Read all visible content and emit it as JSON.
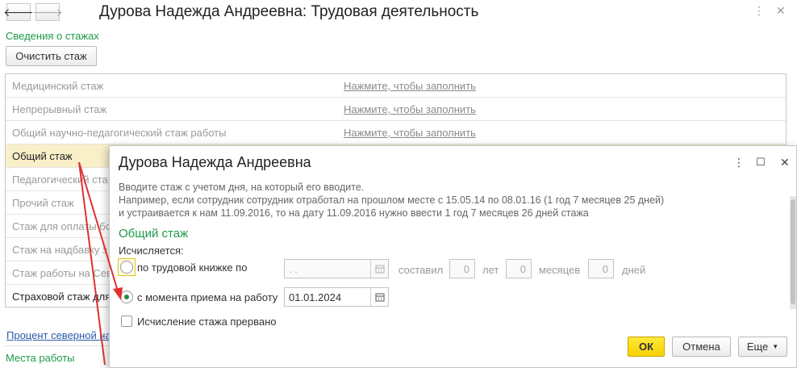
{
  "window": {
    "title": "Дурова Надежда Андреевна: Трудовая деятельность",
    "back_icon": "arrow-left-icon",
    "forward_icon": "arrow-right-icon",
    "more_icon": "more-vert-icon",
    "close_icon": "close-icon"
  },
  "stazh_section": {
    "title": "Сведения о стажах",
    "clear_button": "Очистить стаж"
  },
  "table": {
    "fill_link": "Нажмите, чтобы заполнить",
    "rows": [
      {
        "label": "Медицинский стаж",
        "value": "Нажмите, чтобы заполнить"
      },
      {
        "label": "Непрерывный стаж",
        "value": "Нажмите, чтобы заполнить"
      },
      {
        "label": "Общий научно-педагогический стаж работы",
        "value": "Нажмите, чтобы заполнить"
      },
      {
        "label": "Общий стаж",
        "value": ""
      },
      {
        "label": "Педагогический ста",
        "value": ""
      },
      {
        "label": "Прочий стаж",
        "value": ""
      },
      {
        "label": "Стаж для оплаты бо",
        "value": ""
      },
      {
        "label": "Стаж на надбавку з",
        "value": ""
      },
      {
        "label": "Стаж работы на Сев",
        "value": ""
      },
      {
        "label": "Страховой стаж для",
        "value": ""
      }
    ]
  },
  "bottom": {
    "northern_link": "Процент северной на",
    "workplaces": "Места работы"
  },
  "dialog": {
    "title": "Дурова Надежда Андреевна",
    "hint_lines": [
      "Вводите стаж с учетом дня, на который его вводите.",
      "Например, если сотрудник сотрудник отработал на прошлом месте с 15.05.14 по 08.01.16 (1 год 7 месяцев 25 дней)",
      "и устраивается к нам 11.09.2016, то на дату 11.09.2016 нужно ввести 1 год 7 месяцев 26 дней стажа"
    ],
    "section_title": "Общий стаж",
    "calculated_label": "Исчисляется:",
    "option_book": "по трудовой книжке по",
    "book_date": " .  .",
    "amounted_label": "составил",
    "years_value": "0",
    "years_label": "лет",
    "months_value": "0",
    "months_label": "месяцев",
    "days_value": "0",
    "days_label": "дней",
    "option_hire": "с момента приема на работу",
    "hire_date": "01.01.2024",
    "interrupted_label": "Исчисление стажа прервано",
    "ok_button": "ОК",
    "cancel_button": "Отмена",
    "more_button": "Еще",
    "selected_option": "hire"
  },
  "colors": {
    "accent_green": "#1e9a4a",
    "selection": "#f9efc8",
    "ok_yellow": "#f6d200",
    "annotation_arrow": "#e03030"
  }
}
